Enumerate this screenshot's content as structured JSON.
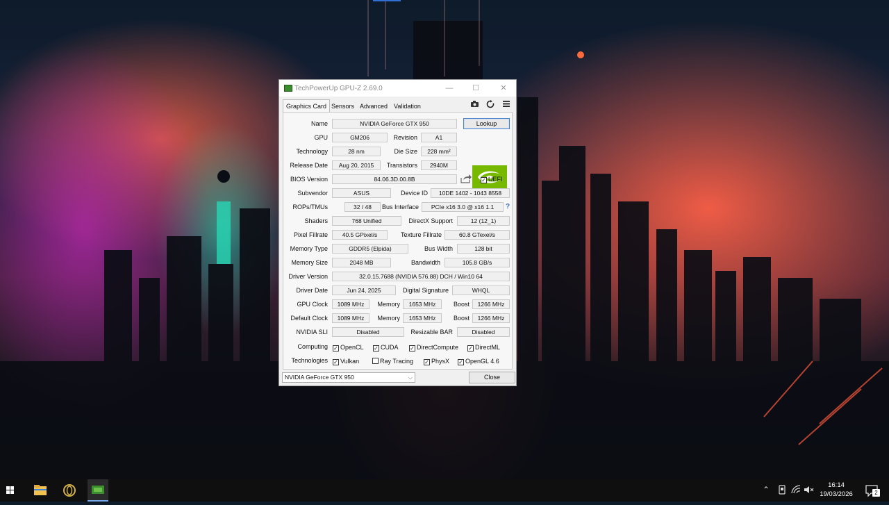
{
  "window": {
    "title": "TechPowerUp GPU-Z 2.69.0",
    "minimize_glyph": "—",
    "maximize_glyph": "☐",
    "close_glyph": "✕"
  },
  "tabs": [
    "Graphics Card",
    "Sensors",
    "Advanced",
    "Validation"
  ],
  "toolbar_icons": [
    "camera-icon",
    "refresh-icon",
    "menu-icon"
  ],
  "labels": {
    "name": "Name",
    "gpu": "GPU",
    "revision": "Revision",
    "technology": "Technology",
    "die_size": "Die Size",
    "release_date": "Release Date",
    "transistors": "Transistors",
    "bios_version": "BIOS Version",
    "uefi": "UEFI",
    "subvendor": "Subvendor",
    "device_id": "Device ID",
    "rops_tmus": "ROPs/TMUs",
    "bus_interface": "Bus Interface",
    "shaders": "Shaders",
    "directx_support": "DirectX Support",
    "pixel_fillrate": "Pixel Fillrate",
    "texture_fillrate": "Texture Fillrate",
    "memory_type": "Memory Type",
    "bus_width": "Bus Width",
    "memory_size": "Memory Size",
    "bandwidth": "Bandwidth",
    "driver_version": "Driver Version",
    "driver_date": "Driver Date",
    "digital_signature": "Digital Signature",
    "gpu_clock": "GPU Clock",
    "memory": "Memory",
    "boost": "Boost",
    "default_clock": "Default Clock",
    "nvidia_sli": "NVIDIA SLI",
    "resizable_bar": "Resizable BAR",
    "computing": "Computing",
    "technologies": "Technologies",
    "help": "?"
  },
  "values": {
    "name": "NVIDIA GeForce GTX 950",
    "gpu": "GM206",
    "revision": "A1",
    "technology": "28 nm",
    "die_size": "228 mm²",
    "release_date": "Aug 20, 2015",
    "transistors": "2940M",
    "bios_version": "84.06.3D.00.8B",
    "subvendor": "ASUS",
    "device_id": "10DE 1402 - 1043 8558",
    "rops_tmus": "32 / 48",
    "bus_interface": "PCIe x16 3.0 @ x16 1.1",
    "shaders": "768 Unified",
    "directx_support": "12 (12_1)",
    "pixel_fillrate": "40.5 GPixel/s",
    "texture_fillrate": "60.8 GTexel/s",
    "memory_type": "GDDR5 (Elpida)",
    "bus_width": "128 bit",
    "memory_size": "2048 MB",
    "bandwidth": "105.8 GB/s",
    "driver_version": "32.0.15.7688 (NVIDIA 576.88) DCH / Win10 64",
    "driver_date": "Jun 24, 2025",
    "digital_signature": "WHQL",
    "gpu_clock": "1089 MHz",
    "gpu_memory": "1653 MHz",
    "gpu_boost": "1266 MHz",
    "default_clock": "1089 MHz",
    "default_memory": "1653 MHz",
    "default_boost": "1266 MHz",
    "nvidia_sli": "Disabled",
    "resizable_bar": "Disabled"
  },
  "checkboxes": {
    "uefi": true,
    "computing": [
      {
        "label": "OpenCL",
        "checked": true
      },
      {
        "label": "CUDA",
        "checked": true
      },
      {
        "label": "DirectCompute",
        "checked": true
      },
      {
        "label": "DirectML",
        "checked": true
      }
    ],
    "technologies": [
      {
        "label": "Vulkan",
        "checked": true
      },
      {
        "label": "Ray Tracing",
        "checked": false
      },
      {
        "label": "PhysX",
        "checked": true
      },
      {
        "label": "OpenGL 4.6",
        "checked": true
      }
    ]
  },
  "buttons": {
    "lookup": "Lookup",
    "close": "Close"
  },
  "logo": {
    "brand_text": "NVIDIA",
    "brand_color": "#76b900"
  },
  "gpu_select": {
    "selected": "NVIDIA GeForce GTX 950"
  },
  "taskbar": {
    "pinned": [
      "file-explorer-icon",
      "opera-gx-icon",
      "gpu-z-icon"
    ],
    "tray_icons": [
      "chevron-up-icon",
      "device-icon",
      "wifi-icon",
      "volume-muted-icon"
    ],
    "time": "16:14",
    "date": "19/03/2026",
    "notification_count": "2"
  },
  "colors": {
    "accent_blue": "#4b7fc6",
    "check_mark": "✓"
  }
}
